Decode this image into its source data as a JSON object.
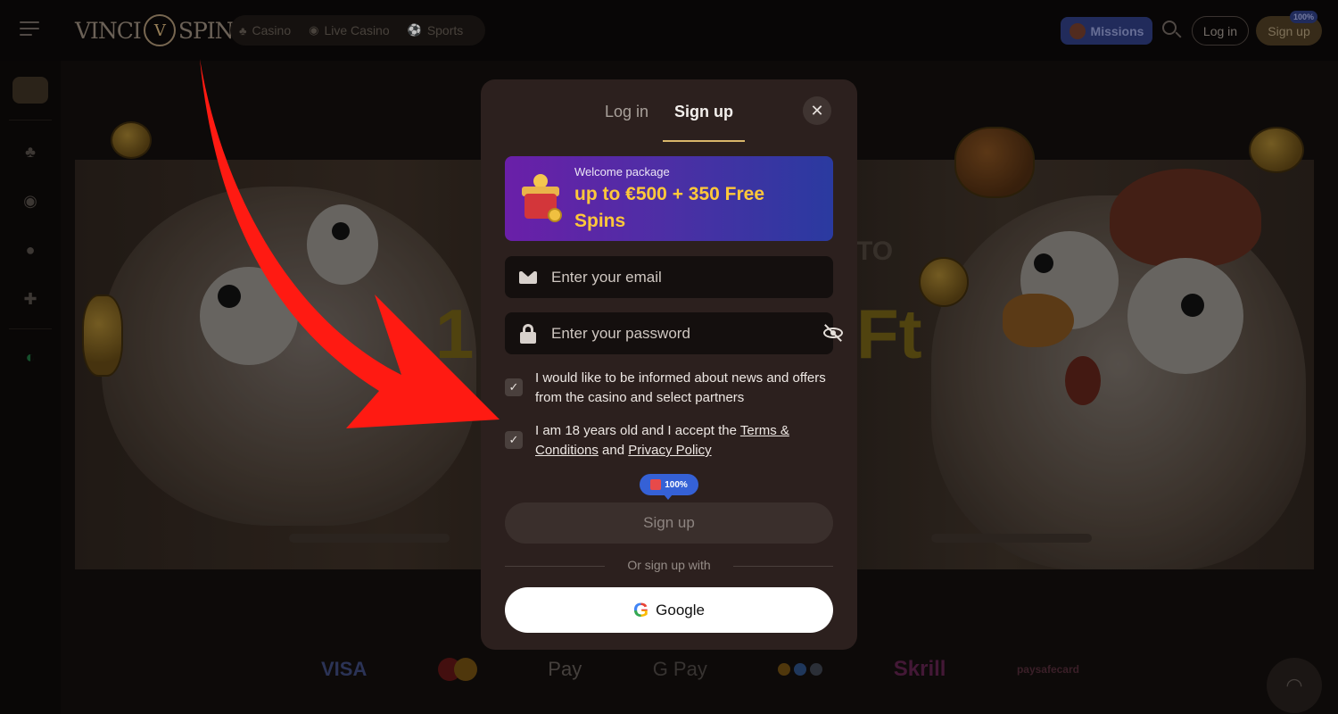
{
  "header": {
    "logo_left": "VINCI",
    "logo_mid": "V",
    "logo_right": "SPIN",
    "nav": [
      {
        "label": "Casino",
        "icon": "cherry-icon"
      },
      {
        "label": "Live Casino",
        "icon": "broadcast-icon"
      },
      {
        "label": "Sports",
        "icon": "ball-icon"
      }
    ],
    "missions_label": "Missions",
    "login_label": "Log in",
    "signup_label": "Sign up",
    "signup_badge": "100%"
  },
  "hero": {
    "to_text": "TO",
    "big_left": "1",
    "big_right": "Ft"
  },
  "modal": {
    "tabs": {
      "login": "Log in",
      "signup": "Sign up"
    },
    "welcome": {
      "small": "Welcome package",
      "big": "up to €500 + 350 Free Spins"
    },
    "email_placeholder": "Enter your email",
    "password_placeholder": "Enter your password",
    "news_consent": "I would like to be informed about news and offers from the casino and select partners",
    "terms_prefix": "I am 18 years old and I accept the ",
    "terms_link": "Terms & Conditions",
    "terms_and": " and ",
    "privacy_link": "Privacy Policy",
    "promo_badge": "100%",
    "signup_button": "Sign up",
    "or_text": "Or sign up with",
    "google_letter": "G",
    "google_label": "Google"
  },
  "payments": {
    "visa": "VISA",
    "apple_pay": "Pay",
    "google_pay": "G Pay",
    "skrill": "Skrill",
    "paysafecard": "paysafecard"
  },
  "colors": {
    "accent_gold": "#d9b66a",
    "welcome_highlight": "#ffc83a",
    "arrow_red": "#ff1a12"
  }
}
